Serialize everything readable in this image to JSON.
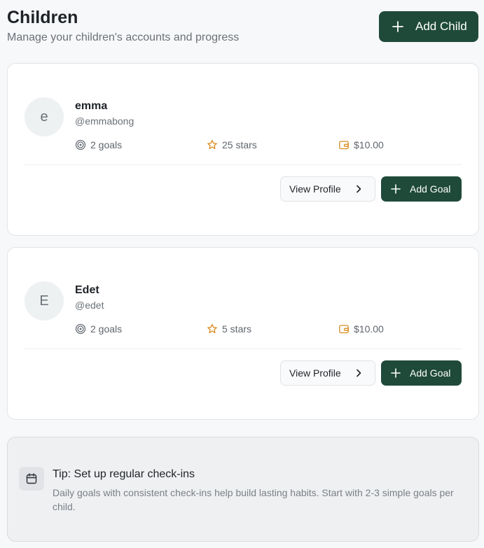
{
  "header": {
    "title": "Children",
    "subtitle": "Manage your children's accounts and progress",
    "add_child_label": "Add Child"
  },
  "children": [
    {
      "initial": "e",
      "name": "emma",
      "handle": "@emmabong",
      "goals": "2 goals",
      "stars": "25 stars",
      "balance": "$10.00",
      "view_profile_label": "View Profile",
      "add_goal_label": "Add Goal"
    },
    {
      "initial": "E",
      "name": "Edet",
      "handle": "@edet",
      "goals": "2 goals",
      "stars": "5 stars",
      "balance": "$10.00",
      "view_profile_label": "View Profile",
      "add_goal_label": "Add Goal"
    }
  ],
  "tip": {
    "title": "Tip: Set up regular check-ins",
    "text": "Daily goals with consistent check-ins help build lasting habits. Start with 2-3 simple goals per child."
  },
  "icons": {
    "add": "plus-icon",
    "goals": "target-icon",
    "stars": "star-icon",
    "balance": "wallet-icon",
    "view": "chevron-right-icon",
    "tip": "calendar-icon"
  },
  "colors": {
    "primary": "#1f4a3a",
    "star": "#d98a1c",
    "wallet": "#d98a1c",
    "muted": "#6b7178"
  }
}
